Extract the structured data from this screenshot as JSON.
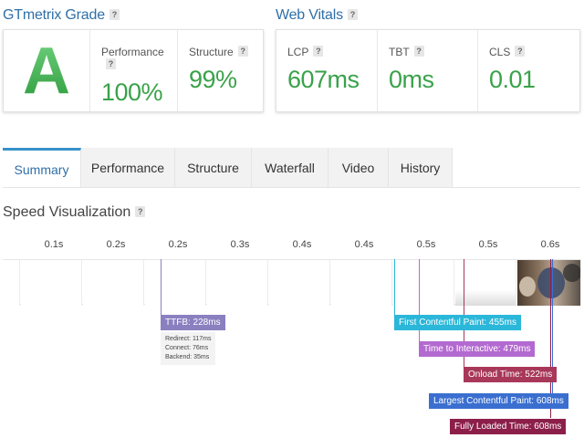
{
  "grade_section": {
    "title": "GTmetrix Grade",
    "grade": "A",
    "metrics": [
      {
        "label": "Performance",
        "value": "100%"
      },
      {
        "label": "Structure",
        "value": "99%"
      }
    ]
  },
  "vitals_section": {
    "title": "Web Vitals",
    "metrics": [
      {
        "label": "LCP",
        "value": "607ms"
      },
      {
        "label": "TBT",
        "value": "0ms"
      },
      {
        "label": "CLS",
        "value": "0.01"
      }
    ]
  },
  "help_glyph": "?",
  "tabs": [
    {
      "label": "Summary",
      "active": true
    },
    {
      "label": "Performance",
      "active": false
    },
    {
      "label": "Structure",
      "active": false
    },
    {
      "label": "Waterfall",
      "active": false
    },
    {
      "label": "Video",
      "active": false
    },
    {
      "label": "History",
      "active": false
    }
  ],
  "speed_visualization": {
    "title": "Speed Visualization",
    "ticks": [
      "0.1s",
      "0.2s",
      "0.2s",
      "0.3s",
      "0.4s",
      "0.4s",
      "0.5s",
      "0.5s",
      "0.6s"
    ],
    "markers": [
      {
        "label": "TTFB: 228ms",
        "color": "#8a80c0",
        "details": [
          "Redirect: 117ms",
          "Connect: 76ms",
          "Backend: 35ms"
        ]
      },
      {
        "label": "First Contentful Paint: 455ms",
        "color": "#2bb7d9"
      },
      {
        "label": "Time to Interactive: 479ms",
        "color": "#b36ad0"
      },
      {
        "label": "Onload Time: 522ms",
        "color": "#a8385a"
      },
      {
        "label": "Largest Contentful Paint: 608ms",
        "color": "#3a6fd0"
      },
      {
        "label": "Fully Loaded Time: 608ms",
        "color": "#8c1f4a"
      }
    ]
  },
  "colors": {
    "brand_blue": "#2f6fa8",
    "grade_green": "#3aa24a",
    "tab_accent": "#3792c9"
  }
}
